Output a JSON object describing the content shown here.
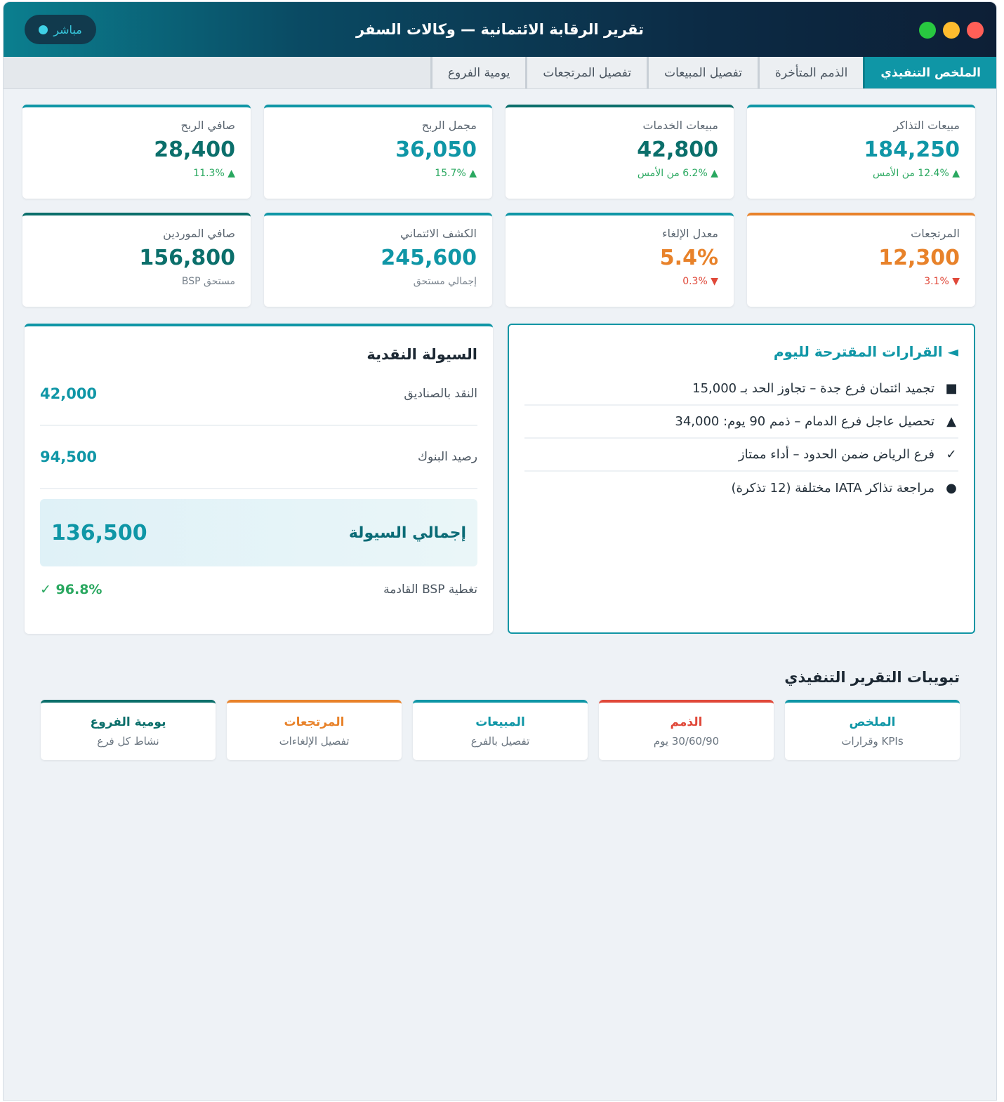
{
  "window": {
    "title": "تقرير الرقابة الائتمانية — وكالات السفر",
    "live_label": "مباشر",
    "traffic_colors": [
      "#ff5f57",
      "#febc2e",
      "#28c840"
    ]
  },
  "tabs": [
    {
      "label": "الملخص التنفيذي",
      "active": true
    },
    {
      "label": "الذمم المتأخرة",
      "active": false
    },
    {
      "label": "تفصيل المبيعات",
      "active": false
    },
    {
      "label": "تفصيل المرتجعات",
      "active": false
    },
    {
      "label": "يومية الفروع",
      "active": false
    }
  ],
  "kpis": [
    {
      "label": "مبيعات التذاكر",
      "value": "184,250",
      "sub": "▲ 12.4% من الأمس",
      "trend": "up",
      "color": "#0f96a6",
      "border": "#0f96a6"
    },
    {
      "label": "مبيعات الخدمات",
      "value": "42,800",
      "sub": "▲ 6.2% من الأمس",
      "trend": "up",
      "color": "#0b6f6b",
      "border": "#0b6f6b"
    },
    {
      "label": "مجمل الربح",
      "value": "36,050",
      "sub": "▲ 15.7%",
      "trend": "up",
      "color": "#0f96a6",
      "border": "#0f96a6"
    },
    {
      "label": "صافي الربح",
      "value": "28,400",
      "sub": "▲ 11.3%",
      "trend": "up",
      "color": "#0b6f6b",
      "border": "#0f96a6"
    },
    {
      "label": "المرتجعات",
      "value": "12,300",
      "sub": "▼ 3.1%",
      "trend": "down",
      "color": "#e8822a",
      "border": "#e8822a"
    },
    {
      "label": "معدل الإلغاء",
      "value": "5.4%",
      "sub": "▼ 0.3%",
      "trend": "down",
      "color": "#e8822a",
      "border": "#0f96a6"
    },
    {
      "label": "الكشف الائتماني",
      "value": "245,600",
      "sub": "إجمالي مستحق",
      "trend": "none",
      "color": "#0f96a6",
      "border": "#0f96a6"
    },
    {
      "label": "صافي الموردين",
      "value": "156,800",
      "sub": "مستحق BSP",
      "trend": "none",
      "color": "#0b6f6b",
      "border": "#0b6f6b"
    }
  ],
  "cash": {
    "title": "السيولة النقدية",
    "rows": [
      {
        "label": "النقد بالصناديق",
        "value": "42,000"
      },
      {
        "label": "رصيد البنوك",
        "value": "94,500"
      }
    ],
    "total_label": "إجمالي السيولة",
    "total_value": "136,500",
    "coverage_label": "تغطية BSP القادمة",
    "coverage_value": "✓ 96.8%"
  },
  "decisions": {
    "title": "◄ القرارات المقترحة لليوم",
    "items": [
      {
        "icon": "■",
        "icon_name": "square-icon",
        "text": "تجميد ائتمان فرع جدة – تجاوز الحد بـ 15,000"
      },
      {
        "icon": "▲",
        "icon_name": "triangle-icon",
        "text": "تحصيل عاجل فرع الدمام – ذمم 90 يوم: 34,000"
      },
      {
        "icon": "✓",
        "icon_name": "check-icon",
        "text": "فرع الرياض ضمن الحدود – أداء ممتاز"
      },
      {
        "icon": "●",
        "icon_name": "circle-icon",
        "text": "مراجعة تذاكر IATA مختلفة (12 تذكرة)"
      }
    ]
  },
  "report_tabs": {
    "heading": "تبويبات التقرير التنفيذي",
    "cards": [
      {
        "title": "الملخص",
        "subtitle": "KPIs وقرارات",
        "color": "#0f96a6"
      },
      {
        "title": "الذمم",
        "subtitle": "30/60/90 يوم",
        "color": "#e0493a"
      },
      {
        "title": "المبيعات",
        "subtitle": "تفصيل بالفرع",
        "color": "#0f96a6"
      },
      {
        "title": "المرتجعات",
        "subtitle": "تفصيل الإلغاءات",
        "color": "#e8822a"
      },
      {
        "title": "يومية الفروع",
        "subtitle": "نشاط كل فرع",
        "color": "#0b6f6b"
      }
    ]
  }
}
